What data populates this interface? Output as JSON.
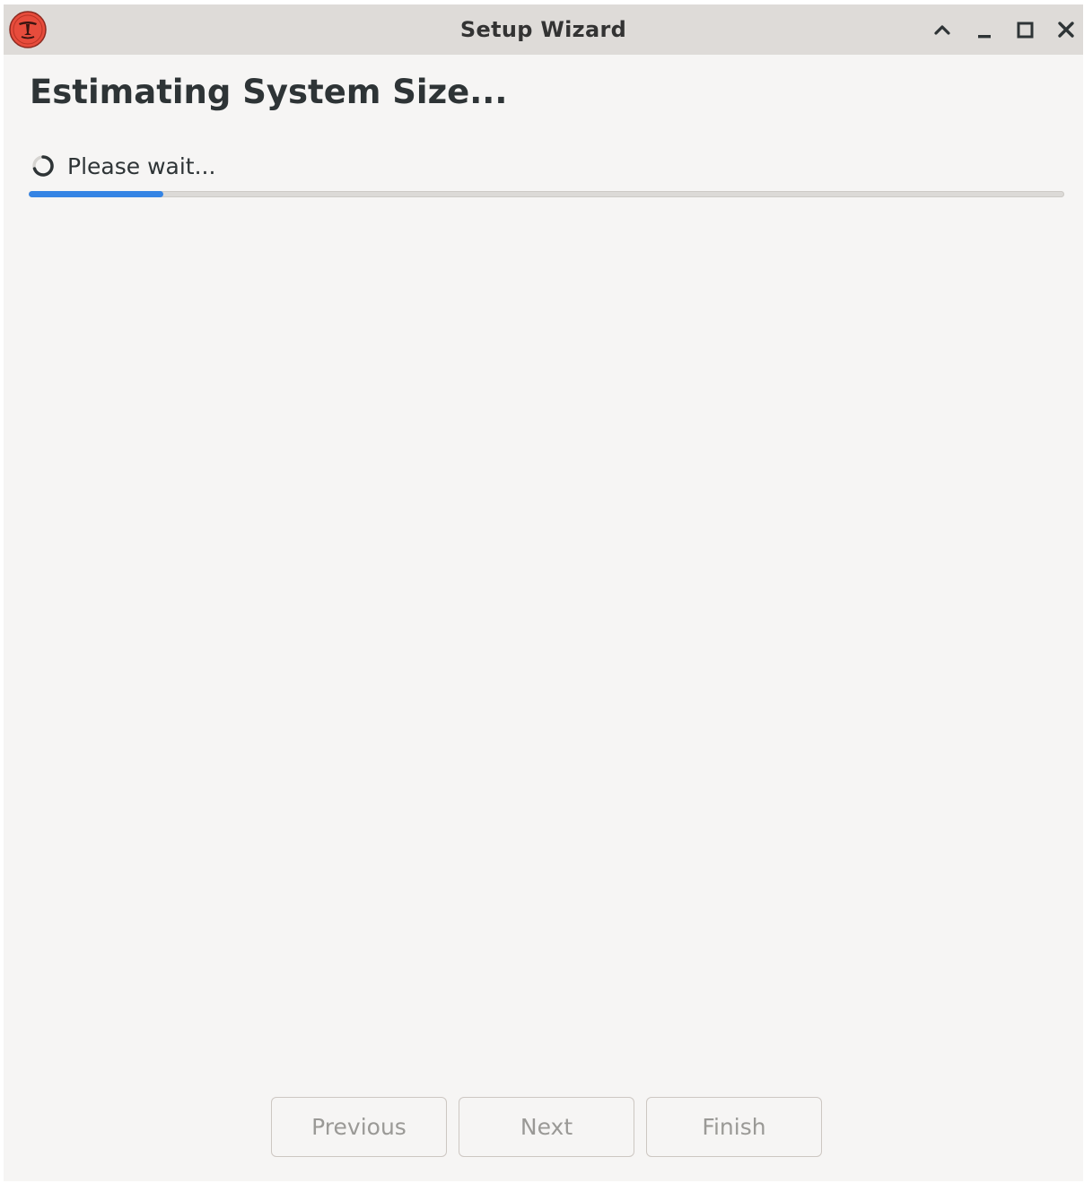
{
  "window": {
    "title": "Setup Wizard"
  },
  "page": {
    "heading": "Estimating System Size...",
    "status_text": "Please wait...",
    "progress_fraction": 0.13
  },
  "buttons": {
    "previous_label": "Previous",
    "next_label": "Next",
    "finish_label": "Finish"
  },
  "icons": {
    "app": "app-logo-icon",
    "shade": "chevron-up-icon",
    "minimize": "minimize-icon",
    "maximize": "maximize-icon",
    "close": "close-icon",
    "spinner": "spinner-icon"
  },
  "colors": {
    "accent": "#3584e4",
    "app_icon": "#e74c3c"
  }
}
